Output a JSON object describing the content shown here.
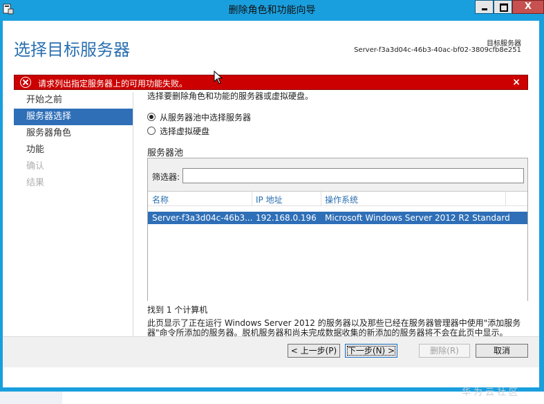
{
  "window": {
    "title": "删除角色和功能向导",
    "colors": {
      "frame": "#1a9fde",
      "accent": "#2e6fb7",
      "error": "#cc0000"
    }
  },
  "header": {
    "page_title": "选择目标服务器",
    "destination_label": "目标服务器",
    "destination_value": "Server-f3a3d04c-46b3-40ac-bf02-3809cfb8e251"
  },
  "error_bar": {
    "message": "请求列出指定服务器上的可用功能失败。",
    "close_glyph": "×"
  },
  "nav": {
    "items": [
      {
        "label": "开始之前",
        "state": "normal"
      },
      {
        "label": "服务器选择",
        "state": "active"
      },
      {
        "label": "服务器角色",
        "state": "normal"
      },
      {
        "label": "功能",
        "state": "normal"
      },
      {
        "label": "确认",
        "state": "disabled"
      },
      {
        "label": "结果",
        "state": "disabled"
      }
    ]
  },
  "main": {
    "instruction": "选择要删除角色和功能的服务器或虚拟硬盘。",
    "radio_pool": "从服务器池中选择服务器",
    "radio_vhd": "选择虚拟硬盘",
    "pool_title": "服务器池",
    "filter_label": "筛选器:",
    "filter_value": "",
    "columns": [
      "名称",
      "IP 地址",
      "操作系统"
    ],
    "rows": [
      {
        "name": "Server-f3a3d04c-46b3...",
        "ip": "192.168.0.196",
        "os": "Microsoft Windows Server 2012 R2 Standard"
      }
    ],
    "found": "找到 1 个计算机",
    "description": "此页显示了正在运行 Windows Server 2012 的服务器以及那些已经在服务器管理器中使用\"添加服务器\"命令所添加的服务器。脱机服务器和尚未完成数据收集的新添加的服务器将不会在此页中显示。"
  },
  "footer": {
    "prev": "< 上一步(P)",
    "next": "下一步(N) >",
    "remove": "删除(R)",
    "cancel": "取消"
  },
  "watermark": "华为云社区"
}
